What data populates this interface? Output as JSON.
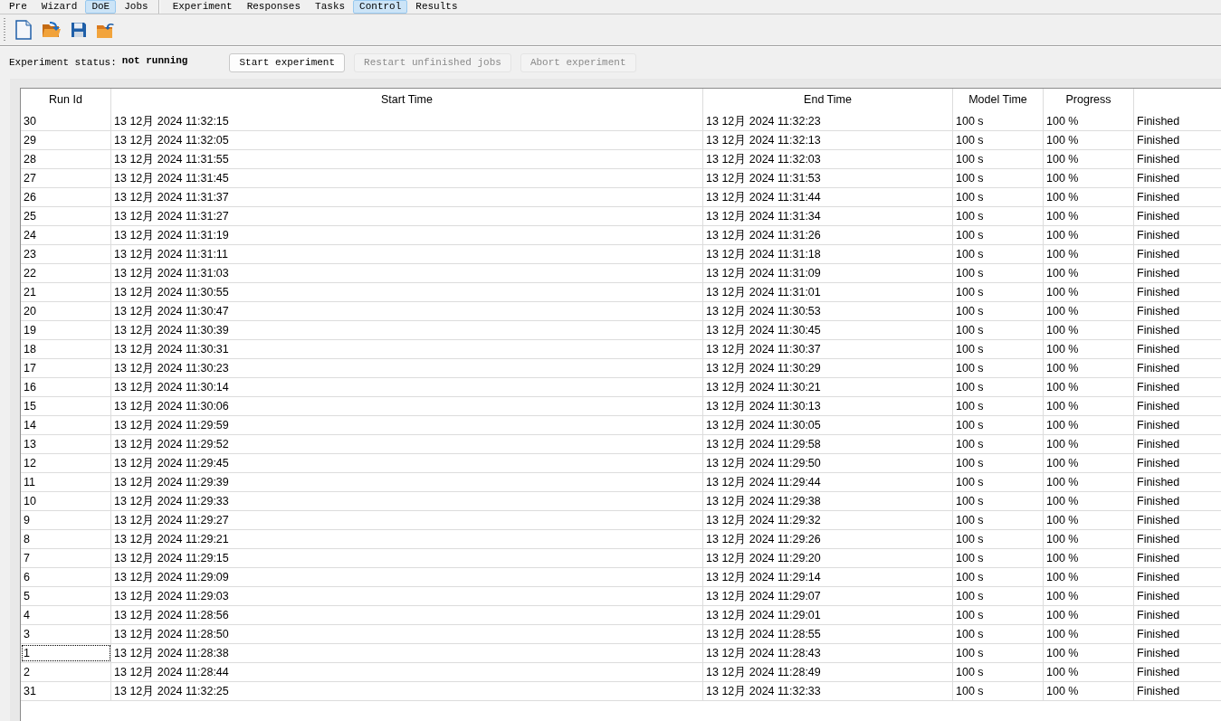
{
  "menu_groups": [
    {
      "tabs": [
        {
          "label": "Pre",
          "selected": false
        },
        {
          "label": "Wizard",
          "selected": false
        },
        {
          "label": "DoE",
          "selected": true
        },
        {
          "label": "Jobs",
          "selected": false
        }
      ]
    },
    {
      "tabs": [
        {
          "label": "Experiment",
          "selected": false
        },
        {
          "label": "Responses",
          "selected": false
        },
        {
          "label": "Tasks",
          "selected": false
        },
        {
          "label": "Control",
          "selected": true
        },
        {
          "label": "Results",
          "selected": false
        }
      ]
    }
  ],
  "status": {
    "label": "Experiment status:",
    "value": "not running"
  },
  "buttons": [
    {
      "label": "Start experiment",
      "disabled": false
    },
    {
      "label": "Restart unfinished jobs",
      "disabled": true
    },
    {
      "label": "Abort experiment",
      "disabled": true
    }
  ],
  "table": {
    "columns": [
      "Run Id",
      "Start Time",
      "End Time",
      "Model Time",
      "Progress"
    ],
    "rows": [
      {
        "run_id": "30",
        "start": "13 12月 2024 11:32:15",
        "end": "13 12月 2024 11:32:23",
        "model_time": "100 s",
        "progress": "100 %",
        "status": "Finished",
        "focused": false
      },
      {
        "run_id": "29",
        "start": "13 12月 2024 11:32:05",
        "end": "13 12月 2024 11:32:13",
        "model_time": "100 s",
        "progress": "100 %",
        "status": "Finished",
        "focused": false
      },
      {
        "run_id": "28",
        "start": "13 12月 2024 11:31:55",
        "end": "13 12月 2024 11:32:03",
        "model_time": "100 s",
        "progress": "100 %",
        "status": "Finished",
        "focused": false
      },
      {
        "run_id": "27",
        "start": "13 12月 2024 11:31:45",
        "end": "13 12月 2024 11:31:53",
        "model_time": "100 s",
        "progress": "100 %",
        "status": "Finished",
        "focused": false
      },
      {
        "run_id": "26",
        "start": "13 12月 2024 11:31:37",
        "end": "13 12月 2024 11:31:44",
        "model_time": "100 s",
        "progress": "100 %",
        "status": "Finished",
        "focused": false
      },
      {
        "run_id": "25",
        "start": "13 12月 2024 11:31:27",
        "end": "13 12月 2024 11:31:34",
        "model_time": "100 s",
        "progress": "100 %",
        "status": "Finished",
        "focused": false
      },
      {
        "run_id": "24",
        "start": "13 12月 2024 11:31:19",
        "end": "13 12月 2024 11:31:26",
        "model_time": "100 s",
        "progress": "100 %",
        "status": "Finished",
        "focused": false
      },
      {
        "run_id": "23",
        "start": "13 12月 2024 11:31:11",
        "end": "13 12月 2024 11:31:18",
        "model_time": "100 s",
        "progress": "100 %",
        "status": "Finished",
        "focused": false
      },
      {
        "run_id": "22",
        "start": "13 12月 2024 11:31:03",
        "end": "13 12月 2024 11:31:09",
        "model_time": "100 s",
        "progress": "100 %",
        "status": "Finished",
        "focused": false
      },
      {
        "run_id": "21",
        "start": "13 12月 2024 11:30:55",
        "end": "13 12月 2024 11:31:01",
        "model_time": "100 s",
        "progress": "100 %",
        "status": "Finished",
        "focused": false
      },
      {
        "run_id": "20",
        "start": "13 12月 2024 11:30:47",
        "end": "13 12月 2024 11:30:53",
        "model_time": "100 s",
        "progress": "100 %",
        "status": "Finished",
        "focused": false
      },
      {
        "run_id": "19",
        "start": "13 12月 2024 11:30:39",
        "end": "13 12月 2024 11:30:45",
        "model_time": "100 s",
        "progress": "100 %",
        "status": "Finished",
        "focused": false
      },
      {
        "run_id": "18",
        "start": "13 12月 2024 11:30:31",
        "end": "13 12月 2024 11:30:37",
        "model_time": "100 s",
        "progress": "100 %",
        "status": "Finished",
        "focused": false
      },
      {
        "run_id": "17",
        "start": "13 12月 2024 11:30:23",
        "end": "13 12月 2024 11:30:29",
        "model_time": "100 s",
        "progress": "100 %",
        "status": "Finished",
        "focused": false
      },
      {
        "run_id": "16",
        "start": "13 12月 2024 11:30:14",
        "end": "13 12月 2024 11:30:21",
        "model_time": "100 s",
        "progress": "100 %",
        "status": "Finished",
        "focused": false
      },
      {
        "run_id": "15",
        "start": "13 12月 2024 11:30:06",
        "end": "13 12月 2024 11:30:13",
        "model_time": "100 s",
        "progress": "100 %",
        "status": "Finished",
        "focused": false
      },
      {
        "run_id": "14",
        "start": "13 12月 2024 11:29:59",
        "end": "13 12月 2024 11:30:05",
        "model_time": "100 s",
        "progress": "100 %",
        "status": "Finished",
        "focused": false
      },
      {
        "run_id": "13",
        "start": "13 12月 2024 11:29:52",
        "end": "13 12月 2024 11:29:58",
        "model_time": "100 s",
        "progress": "100 %",
        "status": "Finished",
        "focused": false
      },
      {
        "run_id": "12",
        "start": "13 12月 2024 11:29:45",
        "end": "13 12月 2024 11:29:50",
        "model_time": "100 s",
        "progress": "100 %",
        "status": "Finished",
        "focused": false
      },
      {
        "run_id": "11",
        "start": "13 12月 2024 11:29:39",
        "end": "13 12月 2024 11:29:44",
        "model_time": "100 s",
        "progress": "100 %",
        "status": "Finished",
        "focused": false
      },
      {
        "run_id": "10",
        "start": "13 12月 2024 11:29:33",
        "end": "13 12月 2024 11:29:38",
        "model_time": "100 s",
        "progress": "100 %",
        "status": "Finished",
        "focused": false
      },
      {
        "run_id": "9",
        "start": "13 12月 2024 11:29:27",
        "end": "13 12月 2024 11:29:32",
        "model_time": "100 s",
        "progress": "100 %",
        "status": "Finished",
        "focused": false
      },
      {
        "run_id": "8",
        "start": "13 12月 2024 11:29:21",
        "end": "13 12月 2024 11:29:26",
        "model_time": "100 s",
        "progress": "100 %",
        "status": "Finished",
        "focused": false
      },
      {
        "run_id": "7",
        "start": "13 12月 2024 11:29:15",
        "end": "13 12月 2024 11:29:20",
        "model_time": "100 s",
        "progress": "100 %",
        "status": "Finished",
        "focused": false
      },
      {
        "run_id": "6",
        "start": "13 12月 2024 11:29:09",
        "end": "13 12月 2024 11:29:14",
        "model_time": "100 s",
        "progress": "100 %",
        "status": "Finished",
        "focused": false
      },
      {
        "run_id": "5",
        "start": "13 12月 2024 11:29:03",
        "end": "13 12月 2024 11:29:07",
        "model_time": "100 s",
        "progress": "100 %",
        "status": "Finished",
        "focused": false
      },
      {
        "run_id": "4",
        "start": "13 12月 2024 11:28:56",
        "end": "13 12月 2024 11:29:01",
        "model_time": "100 s",
        "progress": "100 %",
        "status": "Finished",
        "focused": false
      },
      {
        "run_id": "3",
        "start": "13 12月 2024 11:28:50",
        "end": "13 12月 2024 11:28:55",
        "model_time": "100 s",
        "progress": "100 %",
        "status": "Finished",
        "focused": false
      },
      {
        "run_id": "1",
        "start": "13 12月 2024 11:28:38",
        "end": "13 12月 2024 11:28:43",
        "model_time": "100 s",
        "progress": "100 %",
        "status": "Finished",
        "focused": true
      },
      {
        "run_id": "2",
        "start": "13 12月 2024 11:28:44",
        "end": "13 12月 2024 11:28:49",
        "model_time": "100 s",
        "progress": "100 %",
        "status": "Finished",
        "focused": false
      },
      {
        "run_id": "31",
        "start": "13 12月 2024 11:32:25",
        "end": "13 12月 2024 11:32:33",
        "model_time": "100 s",
        "progress": "100 %",
        "status": "Finished",
        "focused": false
      }
    ]
  }
}
